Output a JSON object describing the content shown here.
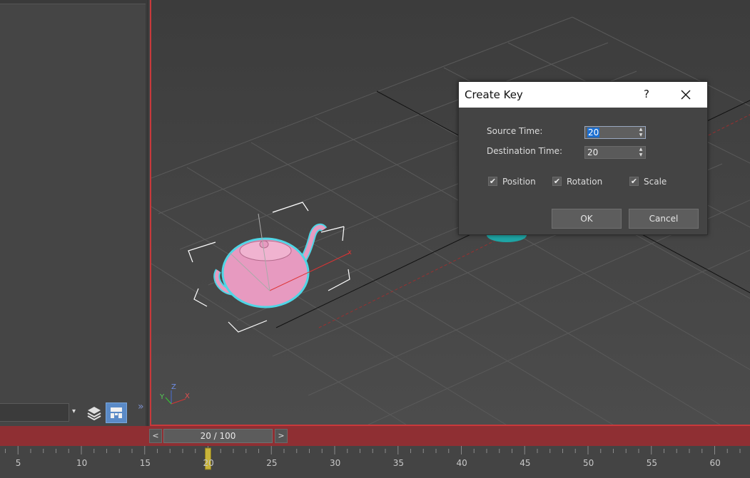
{
  "dialog": {
    "title": "Create Key",
    "help_label": "?",
    "source_time_label": "Source Time:",
    "source_time_value": "20",
    "destination_time_label": "Destination Time:",
    "destination_time_value": "20",
    "checkboxes": [
      {
        "label": "Position",
        "checked": true
      },
      {
        "label": "Rotation",
        "checked": true
      },
      {
        "label": "Scale",
        "checked": true
      }
    ],
    "ok_label": "OK",
    "cancel_label": "Cancel"
  },
  "viewport": {
    "axis_labels": {
      "x": "X",
      "y": "Y",
      "z": "Z"
    }
  },
  "timeline": {
    "prev_label": "<",
    "next_label": ">",
    "slider_text": "20 / 100",
    "current_frame": 20,
    "ticks": [
      "5",
      "10",
      "15",
      "20",
      "25",
      "30",
      "35",
      "40",
      "45",
      "50",
      "55",
      "60"
    ]
  },
  "colors": {
    "viewport_border": "#c8393b",
    "time_bar": "#8f2f33",
    "selection_outline": "#4fd6e6",
    "teapot": "#e79ac0",
    "accent_button": "#5a8ac7"
  },
  "icons": [
    "layers-icon",
    "viewport-layout-icon",
    "expand-icon",
    "close-icon",
    "spinner-arrows-icon",
    "checkmark-icon"
  ]
}
